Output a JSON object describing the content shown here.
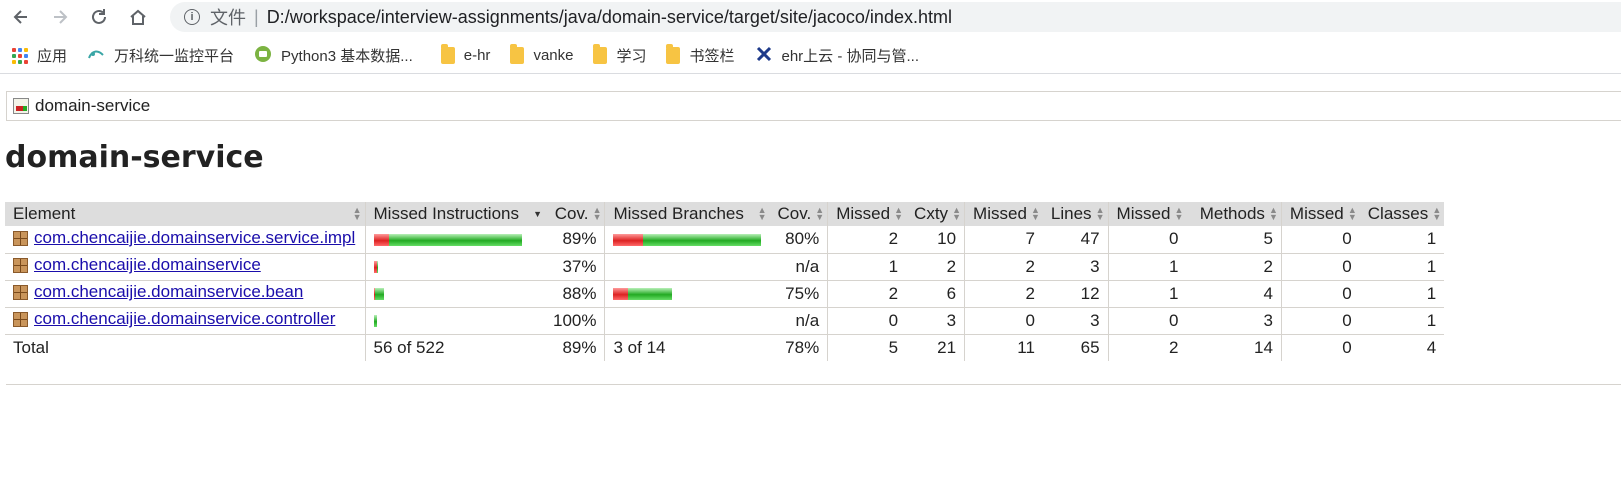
{
  "browser": {
    "scheme_label": "文件",
    "url": "D:/workspace/interview-assignments/java/domain-service/target/site/jacoco/index.html",
    "bookmarks": [
      {
        "label": "应用",
        "icon": "apps-icon"
      },
      {
        "label": "万科统一监控平台",
        "icon": "monitor-icon"
      },
      {
        "label": "Python3 基本数据...",
        "icon": "python-icon"
      },
      {
        "label": "e-hr",
        "icon": "folder-icon"
      },
      {
        "label": "vanke",
        "icon": "folder-icon"
      },
      {
        "label": "学习",
        "icon": "folder-icon"
      },
      {
        "label": "书签栏",
        "icon": "folder-icon"
      },
      {
        "label": "ehr上云 - 协同与管...",
        "icon": "ehr-icon"
      }
    ]
  },
  "breadcrumb": {
    "label": "domain-service"
  },
  "page": {
    "title": "domain-service"
  },
  "table": {
    "headers": [
      "Element",
      "Missed Instructions",
      "Cov.",
      "Missed Branches",
      "Cov.",
      "Missed",
      "Cxty",
      "Missed",
      "Lines",
      "Missed",
      "Methods",
      "Missed",
      "Classes"
    ],
    "rows": [
      {
        "name": "com.chencaijie.domainservice.service.impl",
        "instr_missed_frac": 0.1,
        "instr_cov": "89%",
        "branch_missed_frac": 0.2,
        "branch_cov": "80%",
        "has_branch_bar": true,
        "cxty_missed": "2",
        "cxty": "10",
        "lines_missed": "7",
        "lines": "47",
        "methods_missed": "0",
        "methods": "5",
        "classes_missed": "0",
        "classes": "1"
      },
      {
        "name": "com.chencaijie.domainservice",
        "instr_missed_frac": 0.63,
        "instr_cov": "37%",
        "branch_missed_frac": 0,
        "branch_cov": "n/a",
        "has_branch_bar": false,
        "cxty_missed": "1",
        "cxty": "2",
        "lines_missed": "2",
        "lines": "3",
        "methods_missed": "1",
        "methods": "2",
        "classes_missed": "0",
        "classes": "1"
      },
      {
        "name": "com.chencaijie.domainservice.bean",
        "instr_missed_frac": 0.12,
        "instr_cov": "88%",
        "branch_missed_frac": 0.25,
        "branch_cov": "75%",
        "has_branch_bar": true,
        "cxty_missed": "2",
        "cxty": "6",
        "lines_missed": "2",
        "lines": "12",
        "methods_missed": "1",
        "methods": "4",
        "classes_missed": "0",
        "classes": "1"
      },
      {
        "name": "com.chencaijie.domainservice.controller",
        "instr_missed_frac": 0,
        "instr_cov": "100%",
        "branch_missed_frac": 0,
        "branch_cov": "n/a",
        "has_branch_bar": false,
        "cxty_missed": "0",
        "cxty": "3",
        "lines_missed": "0",
        "lines": "3",
        "methods_missed": "0",
        "methods": "3",
        "classes_missed": "0",
        "classes": "1"
      }
    ],
    "bar_relative_size": [
      1.0,
      0.03,
      0.07,
      0.02
    ],
    "branch_bar_relative_size": [
      1.0,
      0,
      0.4,
      0
    ],
    "total": {
      "label": "Total",
      "instr": "56 of 522",
      "instr_cov": "89%",
      "branch": "3 of 14",
      "branch_cov": "78%",
      "cxty_missed": "5",
      "cxty": "21",
      "lines_missed": "11",
      "lines": "65",
      "methods_missed": "2",
      "methods": "14",
      "classes_missed": "0",
      "classes": "4"
    }
  },
  "colors": {
    "missed": "#dd2222",
    "covered": "#22aa22",
    "link": "#1a0dab"
  }
}
